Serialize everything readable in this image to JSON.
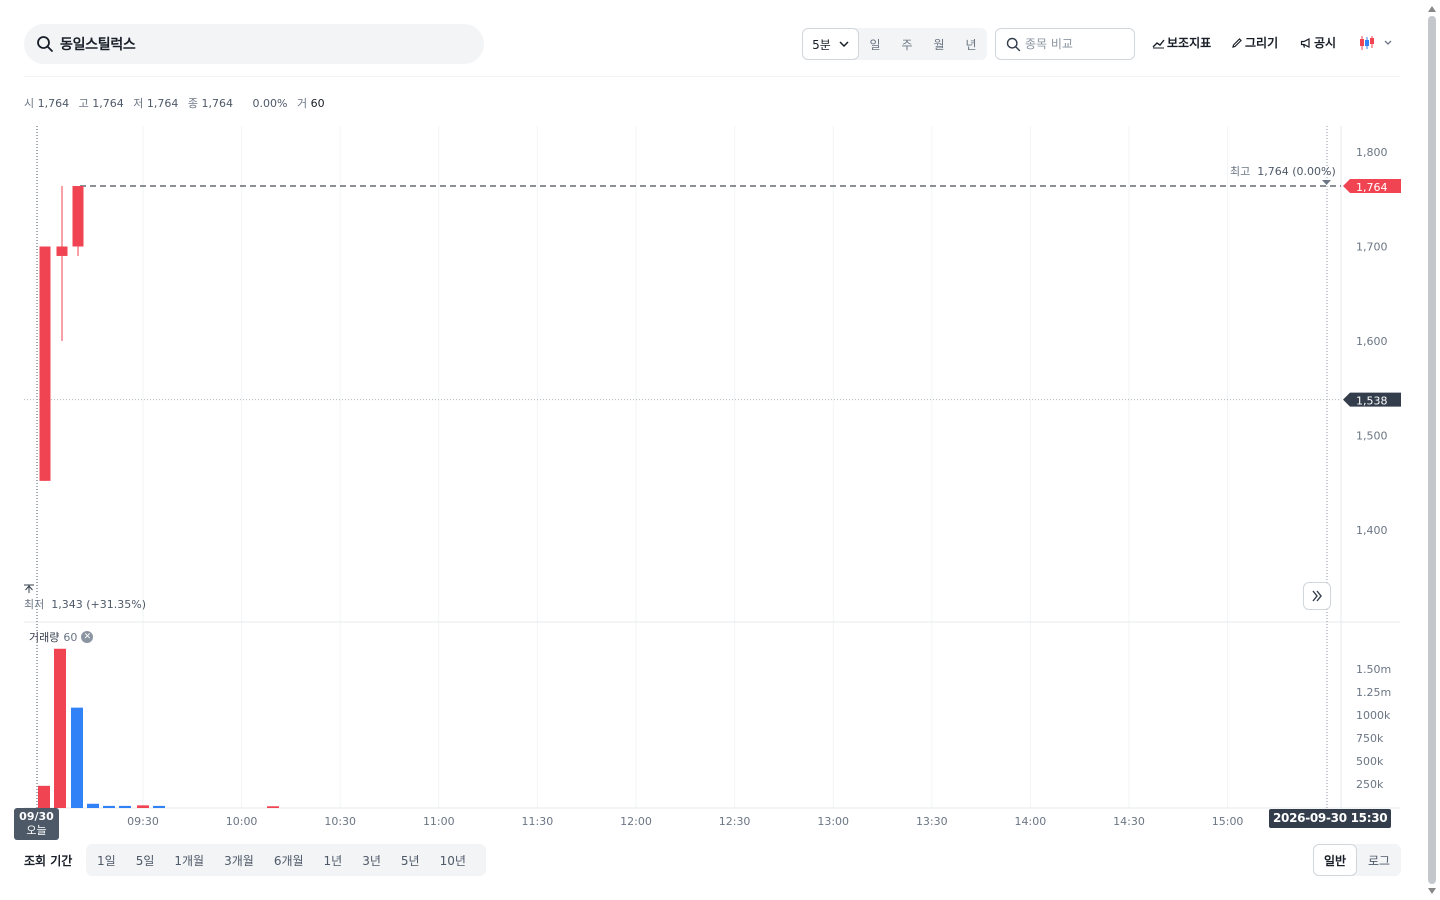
{
  "header": {
    "stock_name": "동일스틸럭스",
    "period_select": "5분",
    "periods": [
      "일",
      "주",
      "월",
      "년"
    ],
    "compare_placeholder": "종목 비교",
    "tools": {
      "indicators": "보조지표",
      "draw": "그리기",
      "disclosure": "공시"
    }
  },
  "ohlc": {
    "open_label": "시",
    "open": "1,764",
    "high_label": "고",
    "high": "1,764",
    "low_label": "저",
    "low": "1,764",
    "close_label": "종",
    "close": "1,764",
    "change": "0.00%",
    "volume_label": "거",
    "volume": "60"
  },
  "markers": {
    "highest_label": "최고",
    "highest_value": "1,764 (0.00%)",
    "lowest_label": "최저",
    "lowest_value": "1,343 (+31.35%)",
    "current_price_tag": "1,764",
    "crosshair_price_tag": "1,538"
  },
  "volume_legend": {
    "label": "거래량",
    "value": "60"
  },
  "date_badge": {
    "date": "09/30",
    "sub": "오늘"
  },
  "end_time_badge": "2026-09-30 15:30",
  "chart_data": {
    "type": "candlestick",
    "interval": "5분",
    "price_axis": {
      "ticks": [
        "1,800",
        "1,700",
        "1,600",
        "1,500",
        "1,400"
      ],
      "tick_values": [
        1800,
        1700,
        1600,
        1500,
        1400
      ],
      "range": [
        1300,
        1850
      ]
    },
    "time_axis": {
      "ticks": [
        "09:30",
        "10:00",
        "10:30",
        "11:00",
        "11:30",
        "12:00",
        "12:30",
        "13:00",
        "13:30",
        "14:00",
        "14:30",
        "15:00"
      ]
    },
    "volume_axis": {
      "ticks": [
        "1.50m",
        "1.25m",
        "1000k",
        "750k",
        "500k",
        "250k"
      ],
      "tick_values": [
        1500000,
        1250000,
        1000000,
        750000,
        500000,
        250000
      ],
      "range": [
        0,
        1750000
      ]
    },
    "candles": [
      {
        "time": "09:00",
        "open": 1452,
        "high": 1700,
        "low": 1452,
        "close": 1700,
        "direction": "up"
      },
      {
        "time": "09:05",
        "open": 1690,
        "high": 1764,
        "low": 1600,
        "close": 1700,
        "direction": "up"
      },
      {
        "time": "09:10",
        "open": 1700,
        "high": 1764,
        "low": 1690,
        "close": 1764,
        "direction": "up"
      }
    ],
    "volumes": [
      {
        "time": "09:00",
        "value": 230000,
        "direction": "up"
      },
      {
        "time": "09:05",
        "value": 1720000,
        "direction": "up"
      },
      {
        "time": "09:10",
        "value": 1080000,
        "direction": "down"
      },
      {
        "time": "09:15",
        "value": 35000,
        "direction": "down"
      },
      {
        "time": "09:20",
        "value": 12000,
        "direction": "down"
      },
      {
        "time": "09:25",
        "value": 12000,
        "direction": "down"
      },
      {
        "time": "09:30",
        "value": 18000,
        "direction": "up"
      },
      {
        "time": "09:35",
        "value": 12000,
        "direction": "down"
      },
      {
        "time": "10:10",
        "value": 8000,
        "direction": "up"
      }
    ],
    "highest": 1764,
    "lowest": 1343,
    "crosshair_price": 1538
  },
  "range": {
    "label": "조회 기간",
    "options": [
      "1일",
      "5일",
      "1개월",
      "3개월",
      "6개월",
      "1년",
      "3년",
      "5년",
      "10년"
    ]
  },
  "scale": {
    "options": [
      "일반",
      "로그"
    ],
    "active": "일반"
  },
  "colors": {
    "up": "#f04452",
    "down": "#3182f6",
    "grid": "#f2f4f6",
    "text": "#6b7684"
  }
}
